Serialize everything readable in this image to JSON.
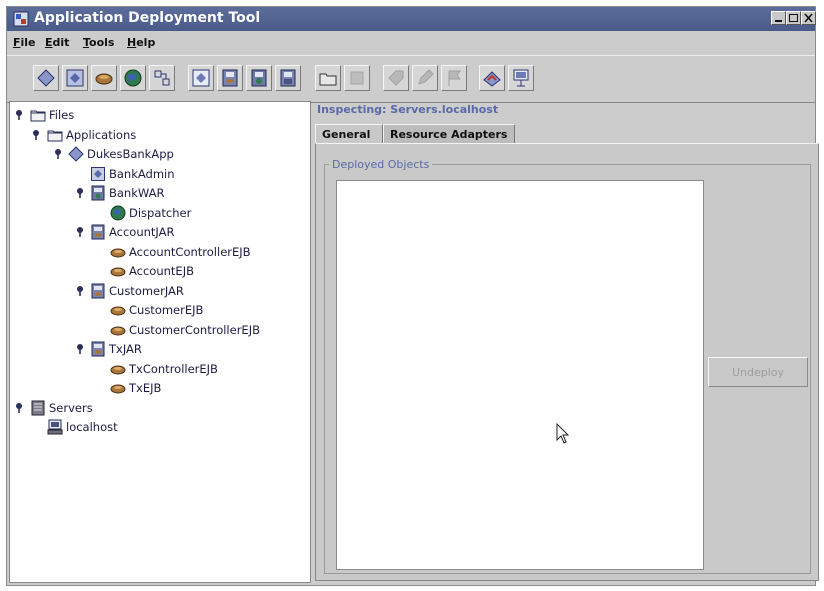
{
  "window": {
    "title": "Application Deployment Tool",
    "controls": [
      "minimize",
      "maximize",
      "close"
    ]
  },
  "menu": {
    "items": [
      {
        "label": "File",
        "mnemonic": "F"
      },
      {
        "label": "Edit",
        "mnemonic": "E"
      },
      {
        "label": "Tools",
        "mnemonic": "T"
      },
      {
        "label": "Help",
        "mnemonic": "H"
      }
    ]
  },
  "toolbar": {
    "buttons": [
      {
        "icon": "new-application-icon",
        "enabled": true
      },
      {
        "icon": "new-app-client-icon",
        "enabled": true
      },
      {
        "icon": "new-ejb-icon",
        "enabled": true
      },
      {
        "icon": "new-web-component-icon",
        "enabled": true
      },
      {
        "icon": "new-connector-icon",
        "enabled": true
      },
      {
        "icon": "open-icon",
        "enabled": true
      },
      {
        "icon": "save-icon",
        "enabled": true
      },
      {
        "icon": "save-as-icon",
        "enabled": true
      },
      {
        "icon": "close-archive-icon",
        "enabled": true
      },
      {
        "icon": "folder-icon",
        "enabled": true
      },
      {
        "icon": "disabled-blank-icon",
        "enabled": false
      },
      {
        "icon": "disabled-tag-icon",
        "enabled": false
      },
      {
        "icon": "disabled-edit-icon",
        "enabled": false
      },
      {
        "icon": "disabled-flag-icon",
        "enabled": false
      },
      {
        "icon": "deploy-icon",
        "enabled": true
      },
      {
        "icon": "server-config-icon",
        "enabled": true
      }
    ]
  },
  "tree": {
    "nodes": [
      {
        "label": "Files",
        "icon": "files-folder-icon",
        "depth": 0,
        "expanded": true
      },
      {
        "label": "Applications",
        "icon": "applications-folder-icon",
        "depth": 1,
        "expanded": true
      },
      {
        "label": "DukesBankApp",
        "icon": "application-icon",
        "depth": 2,
        "expanded": true
      },
      {
        "label": "BankAdmin",
        "icon": "client-icon",
        "depth": 3,
        "expanded": null
      },
      {
        "label": "BankWAR",
        "icon": "war-icon",
        "depth": 3,
        "expanded": true
      },
      {
        "label": "Dispatcher",
        "icon": "web-component-icon",
        "depth": 4,
        "expanded": null
      },
      {
        "label": "AccountJAR",
        "icon": "jar-icon",
        "depth": 3,
        "expanded": true
      },
      {
        "label": "AccountControllerEJB",
        "icon": "ejb-bean-icon",
        "depth": 4,
        "expanded": null
      },
      {
        "label": "AccountEJB",
        "icon": "ejb-bean-icon",
        "depth": 4,
        "expanded": null
      },
      {
        "label": "CustomerJAR",
        "icon": "jar-icon",
        "depth": 3,
        "expanded": true
      },
      {
        "label": "CustomerEJB",
        "icon": "ejb-bean-icon",
        "depth": 4,
        "expanded": null
      },
      {
        "label": "CustomerControllerEJB",
        "icon": "ejb-bean-icon",
        "depth": 4,
        "expanded": null
      },
      {
        "label": "TxJAR",
        "icon": "jar-icon",
        "depth": 3,
        "expanded": true
      },
      {
        "label": "TxControllerEJB",
        "icon": "ejb-bean-icon",
        "depth": 4,
        "expanded": null
      },
      {
        "label": "TxEJB",
        "icon": "ejb-bean-icon",
        "depth": 4,
        "expanded": null
      },
      {
        "label": "Servers",
        "icon": "servers-icon",
        "depth": 0,
        "expanded": true
      },
      {
        "label": "localhost",
        "icon": "host-icon",
        "depth": 1,
        "expanded": null
      }
    ]
  },
  "inspector": {
    "title": "Inspecting: Servers.localhost",
    "tabs": [
      {
        "label": "General",
        "active": true
      },
      {
        "label": "Resource Adapters",
        "active": false
      }
    ],
    "group_label": "Deployed Objects",
    "undeploy_label": "Undeploy",
    "undeploy_enabled": false
  }
}
